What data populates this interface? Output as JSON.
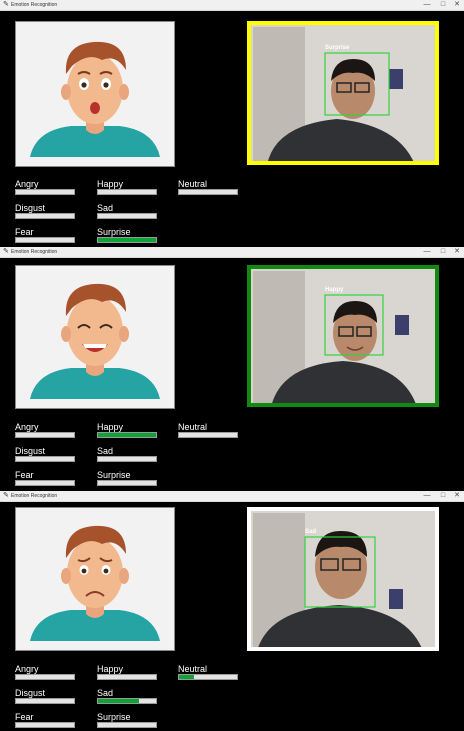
{
  "window": {
    "title": "Emotion Recognition",
    "app_icon": "feather-icon",
    "controls": [
      "—",
      "□",
      "✕"
    ]
  },
  "emotions": [
    "Angry",
    "Happy",
    "Neutral",
    "Disgust",
    "Sad",
    "Fear",
    "Surprise"
  ],
  "panels": [
    {
      "detected": "Surprise",
      "frame_color": "#ffff00",
      "bars": {
        "Angry": 0.0,
        "Happy": 0.0,
        "Neutral": 0.0,
        "Disgust": 0.0,
        "Sad": 0.0,
        "Fear": 0.0,
        "Surprise": 1.0
      }
    },
    {
      "detected": "Happy",
      "frame_color": "#118a11",
      "bars": {
        "Angry": 0.0,
        "Happy": 1.0,
        "Neutral": 0.0,
        "Disgust": 0.0,
        "Sad": 0.0,
        "Fear": 0.0,
        "Surprise": 0.0
      }
    },
    {
      "detected": "Sad",
      "frame_color": "#ffffff",
      "bars": {
        "Angry": 0.0,
        "Happy": 0.0,
        "Neutral": 0.25,
        "Disgust": 0.0,
        "Sad": 0.7,
        "Fear": 0.0,
        "Surprise": 0.0
      }
    }
  ],
  "colors": {
    "bar_fill": "#0ea336",
    "bar_empty": "#e3e3e3",
    "face_box": "#34d13e"
  }
}
